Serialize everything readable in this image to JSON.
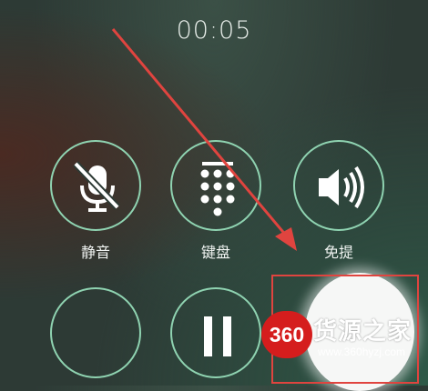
{
  "call": {
    "timer": "00:05"
  },
  "controls": {
    "mute_label": "静音",
    "keypad_label": "键盘",
    "speaker_label": "免提"
  },
  "watermark": {
    "logo_text": "360",
    "title": "货源之家",
    "url": "www.360hyzj.com"
  },
  "colors": {
    "button_ring": "#8fd3b1",
    "arrow": "#e0443f",
    "highlight": "#e0443f"
  },
  "icons": [
    "mic-muted-icon",
    "keypad-icon",
    "speaker-icon",
    "pause-icon"
  ]
}
